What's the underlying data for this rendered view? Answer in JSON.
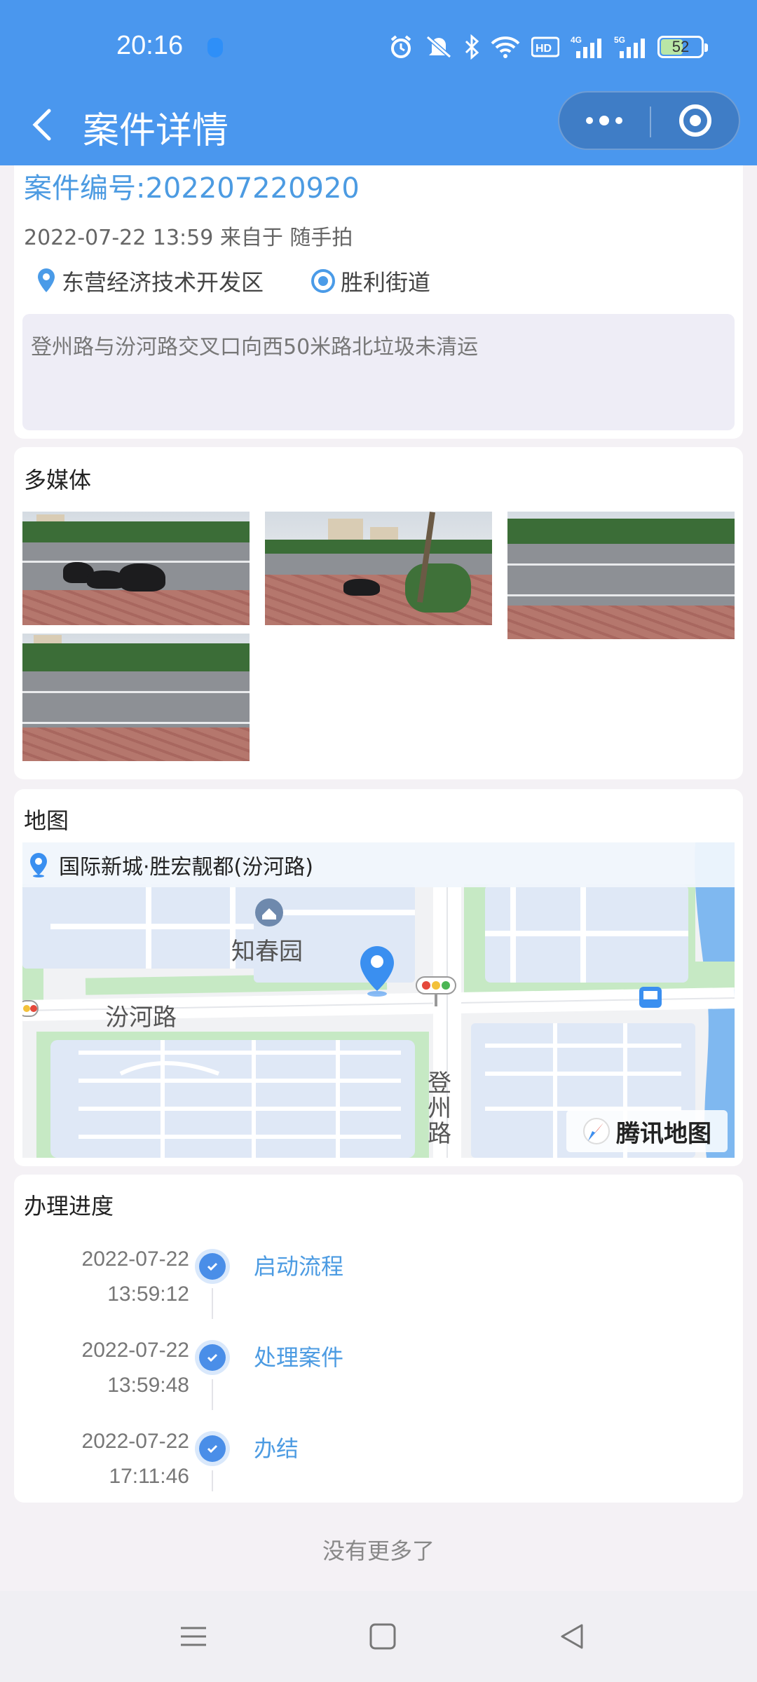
{
  "status_bar": {
    "time": "20:16",
    "battery": "52",
    "battery_level": 0.52,
    "icons": [
      "alarm-icon",
      "mute-icon",
      "bluetooth-icon",
      "wifi-icon",
      "hd-icon",
      "4g-signal-icon",
      "5g-signal-icon",
      "battery-icon"
    ]
  },
  "header": {
    "title": "案件详情",
    "back_icon": "chevron-left-icon",
    "more_icon": "more-dots-icon",
    "close_icon": "target-icon"
  },
  "case": {
    "number_label": "案件编号:202207220920",
    "meta": "2022-07-22 13:59 来自于 随手拍",
    "district": "东营经济技术开发区",
    "street": "胜利街道",
    "description": "登州路与汾河路交叉口向西50米路北垃圾未清运"
  },
  "media": {
    "title": "多媒体",
    "photos": [
      "photo-1",
      "photo-2",
      "photo-3",
      "photo-4"
    ]
  },
  "map": {
    "title": "地图",
    "address": "国际新城·胜宏靓都(汾河路)",
    "labels": {
      "poi": "知春园",
      "road_h": "汾河路",
      "road_v": "登州路"
    },
    "brand": "腾讯地图",
    "colors": {
      "green": "#c6e9c4",
      "block": "#dfe8f6",
      "water": "#7fb8f0",
      "pin": "#3a8ff0"
    }
  },
  "progress": {
    "title": "办理进度",
    "steps": [
      {
        "date": "2022-07-22",
        "time": "13:59:12",
        "label": "启动流程"
      },
      {
        "date": "2022-07-22",
        "time": "13:59:48",
        "label": "处理案件"
      },
      {
        "date": "2022-07-22",
        "time": "17:11:46",
        "label": "办结"
      }
    ]
  },
  "footer": {
    "no_more": "没有更多了"
  },
  "nav": {
    "menu_icon": "menu-icon",
    "home_icon": "square-home-icon",
    "back_icon": "triangle-back-icon"
  }
}
